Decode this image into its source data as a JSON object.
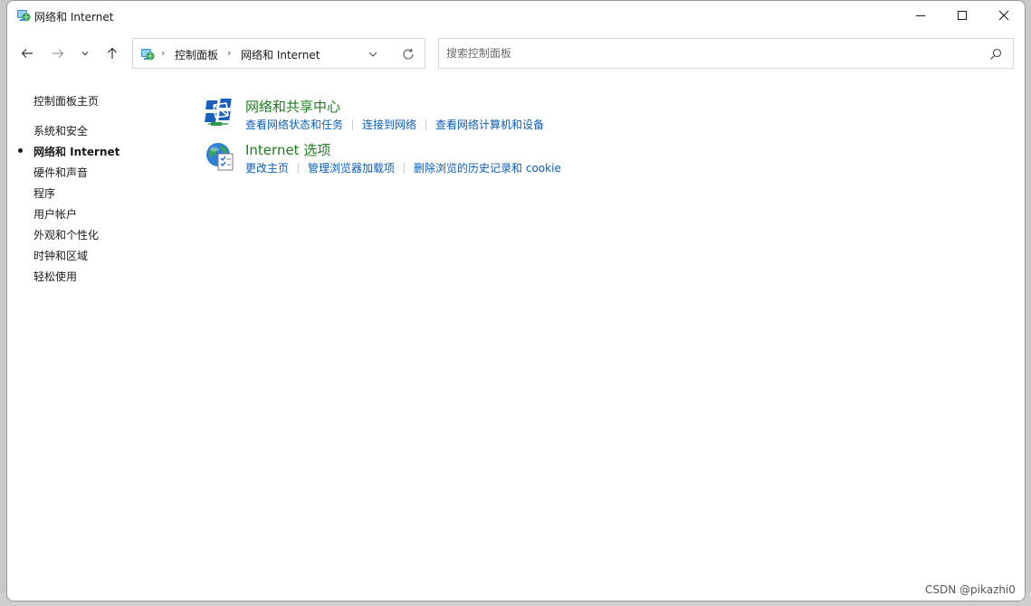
{
  "window": {
    "title": "网络和 Internet"
  },
  "address": {
    "crumbs": [
      "控制面板",
      "网络和 Internet"
    ]
  },
  "search": {
    "placeholder": "搜索控制面板"
  },
  "sidebar": {
    "home": "控制面板主页",
    "items": [
      {
        "label": "系统和安全",
        "active": false
      },
      {
        "label": "网络和 Internet",
        "active": true
      },
      {
        "label": "硬件和声音",
        "active": false
      },
      {
        "label": "程序",
        "active": false
      },
      {
        "label": "用户帐户",
        "active": false
      },
      {
        "label": "外观和个性化",
        "active": false
      },
      {
        "label": "时钟和区域",
        "active": false
      },
      {
        "label": "轻松使用",
        "active": false
      }
    ]
  },
  "categories": [
    {
      "title": "网络和共享中心",
      "icon": "network-sharing-center-icon",
      "links": [
        "查看网络状态和任务",
        "连接到网络",
        "查看网络计算机和设备"
      ]
    },
    {
      "title": "Internet 选项",
      "icon": "internet-options-icon",
      "links": [
        "更改主页",
        "管理浏览器加载项",
        "删除浏览的历史记录和 cookie"
      ]
    }
  ],
  "colors": {
    "category_title": "#1e7d1e",
    "link": "#0b5db8"
  },
  "watermark": "CSDN @pikazhi0"
}
